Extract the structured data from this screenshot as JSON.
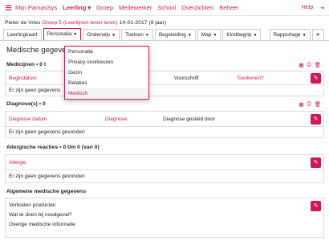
{
  "nav": {
    "app_name": "Mijn ParnasSys",
    "items": [
      "Leerling",
      "Groep",
      "Medewerker",
      "School",
      "Overzichten",
      "Beheer"
    ],
    "help": "Help",
    "colors": {
      "accent": "#d0195b"
    }
  },
  "student": {
    "name": "Pieter de Vries",
    "group": "Groep 5 (Leerlijnen leren leren)",
    "dob": "14-01-2017 (8 jaar)"
  },
  "tabs": {
    "items": [
      "Leerlingkaart",
      "Personalia",
      "Onderwijs",
      "Toetsen",
      "Begeleiding",
      "Map",
      "Kindbegrip"
    ],
    "right": "Rapportage",
    "close": "✕"
  },
  "dropdown": {
    "items": [
      "Personalia",
      "Privacy-voorkeuren",
      "Gezin",
      "Relaties",
      "Medisch"
    ],
    "active": "Medisch"
  },
  "page_title": "Medische gegevens",
  "sections": {
    "medicijnen": {
      "title": "Medicijnen • 0 t",
      "headers": [
        "Begindatum",
        "Voorschrift",
        "Toedienen?"
      ],
      "empty": "Er zijn geen gegevens"
    },
    "diagnoses": {
      "title": "Diagnose(s) • 0",
      "headers": [
        "Diagnose datum",
        "Diagnose",
        "Diagnose gesteld door"
      ],
      "empty": "Er zijn geen gegevens gevonden"
    },
    "allergie": {
      "title": "Allergische reacties • 0 t/m 0 (van 0)",
      "headers": [
        "Allergie"
      ],
      "empty": "Er zijn geen gegevens gevonden"
    },
    "algemeen": {
      "title": "Algemene medische gegevens",
      "lines": [
        "Verboden producten",
        "Wat te doen bij noodgeval?",
        "Overige medische informatie"
      ]
    }
  },
  "icons": [
    "calendar-icon",
    "print-icon",
    "delete-icon",
    "edit-icon",
    "logo-icon"
  ]
}
